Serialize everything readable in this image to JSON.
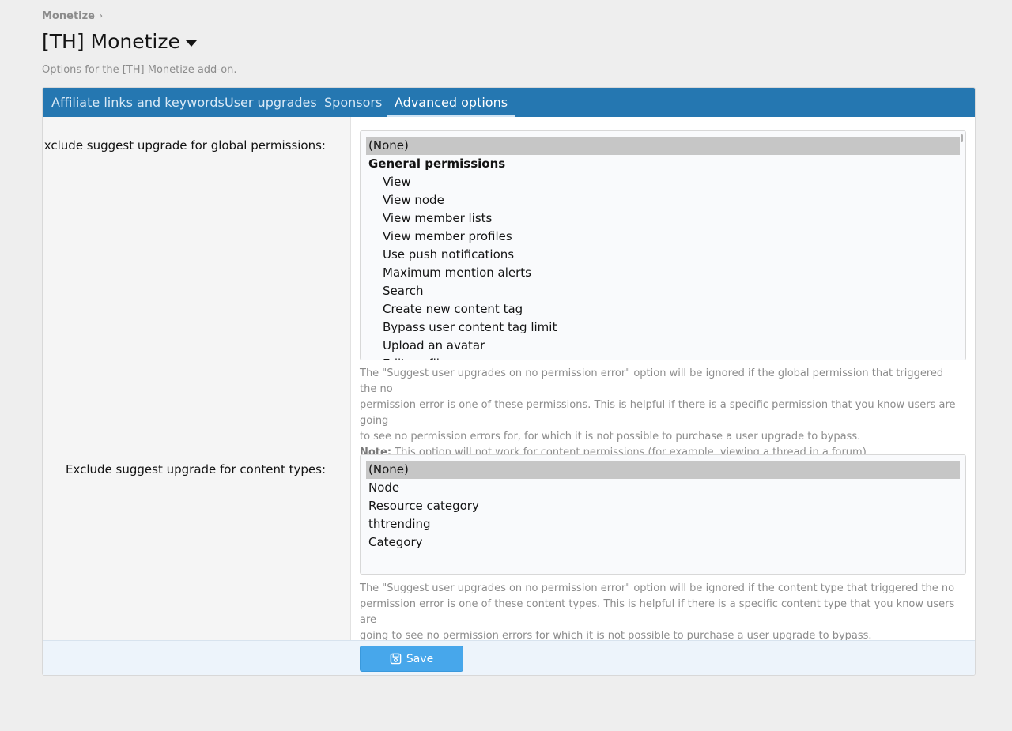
{
  "breadcrumb": {
    "item": "Monetize",
    "separator": "›"
  },
  "page": {
    "title": "[TH] Monetize",
    "description": "Options for the [TH] Monetize add-on."
  },
  "tabs": [
    {
      "label": "Affiliate links and keywords"
    },
    {
      "label": "User upgrades"
    },
    {
      "label": "Sponsors"
    },
    {
      "label": "Advanced options",
      "active": true
    }
  ],
  "global_permissions": {
    "label": "Exclude suggest upgrade for global permissions:",
    "options": [
      {
        "label": "(None)",
        "selected": true
      },
      {
        "label": "General permissions",
        "group": true
      },
      {
        "label": "View"
      },
      {
        "label": "View node"
      },
      {
        "label": "View member lists"
      },
      {
        "label": "View member profiles"
      },
      {
        "label": "Use push notifications"
      },
      {
        "label": "Maximum mention alerts"
      },
      {
        "label": "Search"
      },
      {
        "label": "Create new content tag"
      },
      {
        "label": "Bypass user content tag limit"
      },
      {
        "label": "Upload an avatar"
      },
      {
        "label": "Edit profile"
      }
    ],
    "hint_lines": [
      "The \"Suggest user upgrades on no permission error\" option will be ignored if the global permission that triggered the no",
      "permission error is one of these permissions. This is helpful if there is a specific permission that you know users are going",
      "to see no permission errors for, for which it is not possible to purchase a user upgrade to bypass."
    ],
    "note_label": "Note:",
    "note_text": " This option will not work for content permissions (for example, viewing a thread in a forum)."
  },
  "content_types": {
    "label": "Exclude suggest upgrade for content types:",
    "options": [
      {
        "label": "(None)",
        "selected": true
      },
      {
        "label": "Node"
      },
      {
        "label": "Resource category"
      },
      {
        "label": "thtrending"
      },
      {
        "label": "Category"
      }
    ],
    "hint_lines": [
      "The \"Suggest user upgrades on no permission error\" option will be ignored if the content type that triggered the no",
      "permission error is one of these content types. This is helpful if there is a specific content type that you know users are",
      "going to see no permission errors for which it is not possible to purchase a user upgrade to bypass."
    ]
  },
  "footer": {
    "save_label": "Save"
  },
  "icons": {
    "caret": "caret-down-icon",
    "save": "save-icon"
  },
  "colors": {
    "tab_bar": "#2577b1",
    "save_button": "#47a7eb",
    "selected_option": "#c6c6c6"
  }
}
